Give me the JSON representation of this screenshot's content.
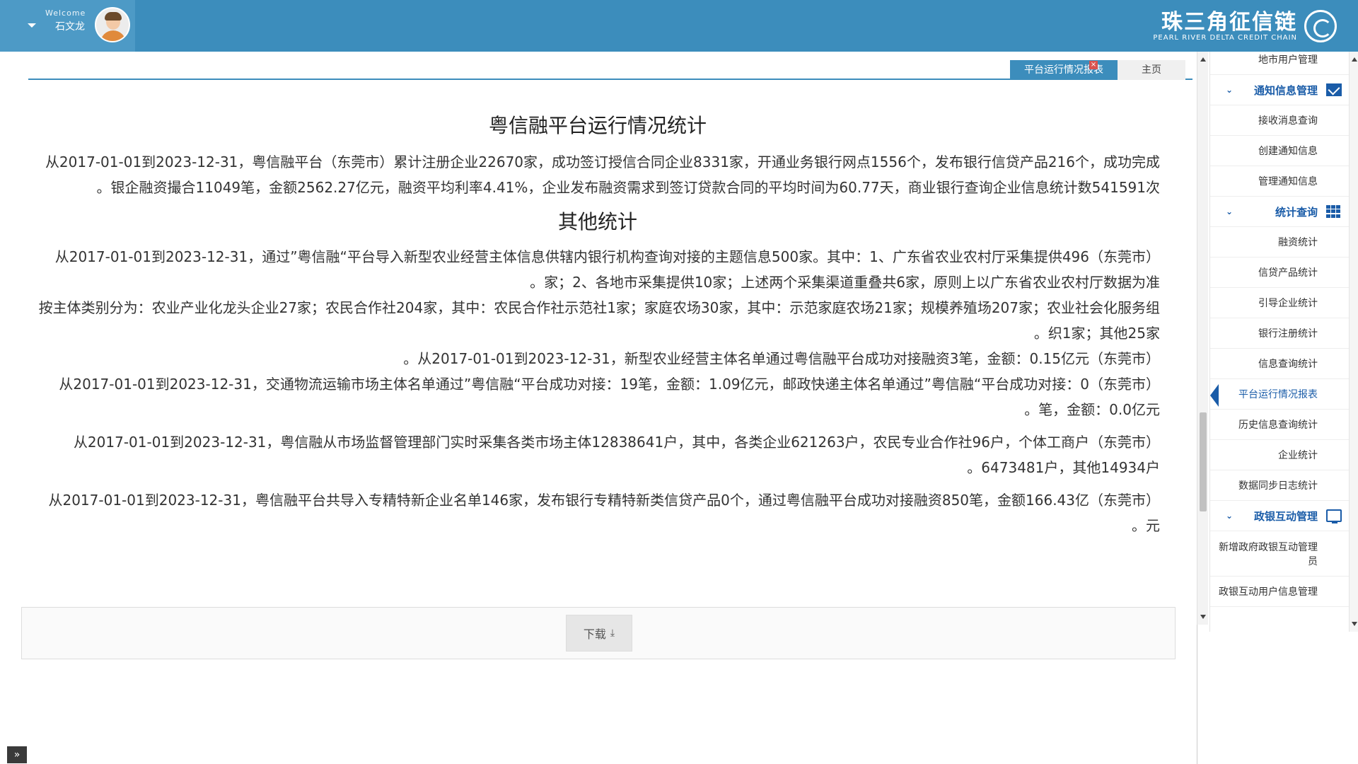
{
  "header": {
    "welcome": "Welcome",
    "username": "石文龙",
    "logo_cn": "珠三角征信链",
    "logo_en": "PEARL RIVER DELTA CREDIT CHAIN"
  },
  "tabs": {
    "active_label": "平台运行情况报表",
    "close_symbol": "×",
    "home_label": "主页"
  },
  "report": {
    "title": "粤信融平台运行情况统计",
    "p1": "从2017-01-01到2023-12-31，粤信融平台（东莞市）累计注册企业22670家，成功签订授信合同企业8331家，开通业务银行网点1556个，发布银行信贷产品216个，成功完成银企融资撮合11049笔，金额2562.27亿元，融资平均利率4.41%，企业发布融资需求到签订贷款合同的平均时间为60.77天，商业银行查询企业信息统计数541591次。",
    "subtitle": "其他统计",
    "p2": "（东莞市）从2017-01-01到2023-12-31，通过”粤信融“平台导入新型农业经营主体信息供辖内银行机构查询对接的主题信息500家。其中：1、广东省农业农村厅采集提供496家；2、各地市采集提供10家；上述两个采集渠道重叠共6家，原则上以广东省农业农村厅数据为准。",
    "p3": "按主体类别分为：农业产业化龙头企业27家；农民合作社204家，其中：农民合作社示范社1家；家庭农场30家，其中：示范家庭农场21家；规模养殖场207家；农业社会化服务组织1家；其他25家。",
    "p4": "（东莞市）从2017-01-01到2023-12-31，新型农业经营主体名单通过粤信融平台成功对接融资3笔，金额：0.15亿元。",
    "p5": "（东莞市）从2017-01-01到2023-12-31，交通物流运输市场主体名单通过”粤信融“平台成功对接：19笔，金额：1.09亿元，邮政快递主体名单通过”粤信融“平台成功对接：0笔，金额：0.0亿元。",
    "p6": "（东莞市）从2017-01-01到2023-12-31，粤信融从市场监督管理部门实时采集各类市场主体12838641户，其中，各类企业621263户，农民专业合作社96户，个体工商户6473481户，其他14934户。",
    "p7": "（东莞市）从2017-01-01到2023-12-31，粤信融平台共导入专精特新企业名单146家，发布银行专精特新类信贷产品0个，通过粤信融平台成功对接融资850笔，金额166.43亿元。",
    "download_label": "下载",
    "download_icon": "download-icon"
  },
  "sidebar": {
    "top_item": "地市用户管理",
    "groups": [
      {
        "label": "通知信息管理",
        "icon": "mail-icon"
      },
      {
        "label": "统计查询",
        "icon": "grid-icon"
      },
      {
        "label": "政银互动管理",
        "icon": "monitor-icon"
      }
    ],
    "notice_items": [
      "接收消息查询",
      "创建通知信息",
      "管理通知信息"
    ],
    "stats_items": [
      "融资统计",
      "信贷产品统计",
      "引导企业统计",
      "银行注册统计",
      "信息查询统计",
      "平台运行情况报表",
      "历史信息查询统计",
      "企业统计",
      "数据同步日志统计"
    ],
    "govbank_items": [
      "新增政府政银互动管理员",
      "政银互动用户信息管理"
    ]
  },
  "misc": {
    "to_top": "»"
  }
}
